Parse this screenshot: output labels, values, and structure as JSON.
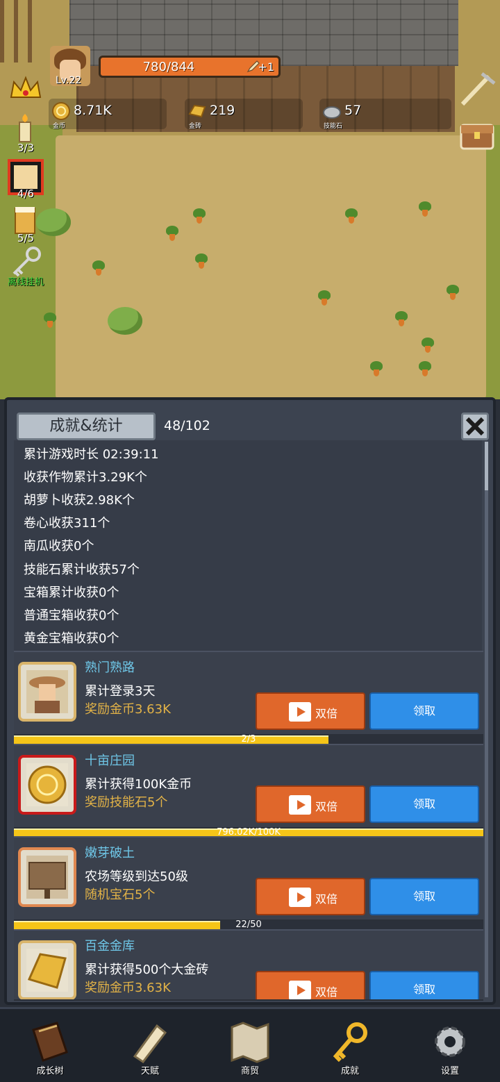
{
  "hud": {
    "level": "Lv.22",
    "hp": "780/844",
    "hp_bonus": "+1",
    "gold": {
      "value": "8.71K",
      "caption": "金币"
    },
    "gold_brick": {
      "value": "219",
      "caption": "金砖"
    },
    "skill_stone": {
      "value": "57",
      "caption": "技能石"
    },
    "side": [
      {
        "label": "3/3",
        "icon": "candle-icon"
      },
      {
        "label": "4/6",
        "icon": "dice-icon"
      },
      {
        "label": "5/5",
        "icon": "beer-mug-icon"
      },
      {
        "label": "离线挂机",
        "icon": "key-icon"
      }
    ]
  },
  "panel": {
    "title": "成就&统计",
    "count": "48/102",
    "stats": [
      "累计游戏时长 02:39:11",
      "收获作物累计3.29K个",
      "胡萝卜收获2.98K个",
      "卷心收获311个",
      "南瓜收获0个",
      "技能石累计收获57个",
      "宝箱累计收获0个",
      "普通宝箱收获0个",
      "黄金宝箱收获0个"
    ],
    "achievements": [
      {
        "name": "熟门熟路",
        "desc": "累计登录3天",
        "reward": "奖励金币3.63K",
        "progress_text": "2/3",
        "progress": 0.67,
        "double_label": "双倍",
        "claim_label": "领取"
      },
      {
        "name": "十亩庄园",
        "desc": "累计获得100K金币",
        "reward": "奖励技能石5个",
        "progress_text": "796.02K/100K",
        "progress": 1.0,
        "double_label": "双倍",
        "claim_label": "领取"
      },
      {
        "name": "嫩芽破土",
        "desc": "农场等级到达50级",
        "reward": "随机宝石5个",
        "progress_text": "22/50",
        "progress": 0.44,
        "double_label": "双倍",
        "claim_label": "领取"
      },
      {
        "name": "百金金库",
        "desc": "累计获得500个大金砖",
        "reward": "奖励金币3.63K",
        "double_label": "双倍",
        "claim_label": "领取"
      }
    ]
  },
  "nav": [
    {
      "label": "成长树",
      "icon": "book-icon"
    },
    {
      "label": "天赋",
      "icon": "scroll-icon"
    },
    {
      "label": "商贸",
      "icon": "map-icon"
    },
    {
      "label": "成就",
      "icon": "key-icon"
    },
    {
      "label": "设置",
      "icon": "gear-icon"
    }
  ],
  "colors": {
    "accent_orange": "#e0672b",
    "claim_blue": "#2f8fe8",
    "reward_gold": "#e3b347",
    "name_cyan": "#6fc7e8"
  }
}
